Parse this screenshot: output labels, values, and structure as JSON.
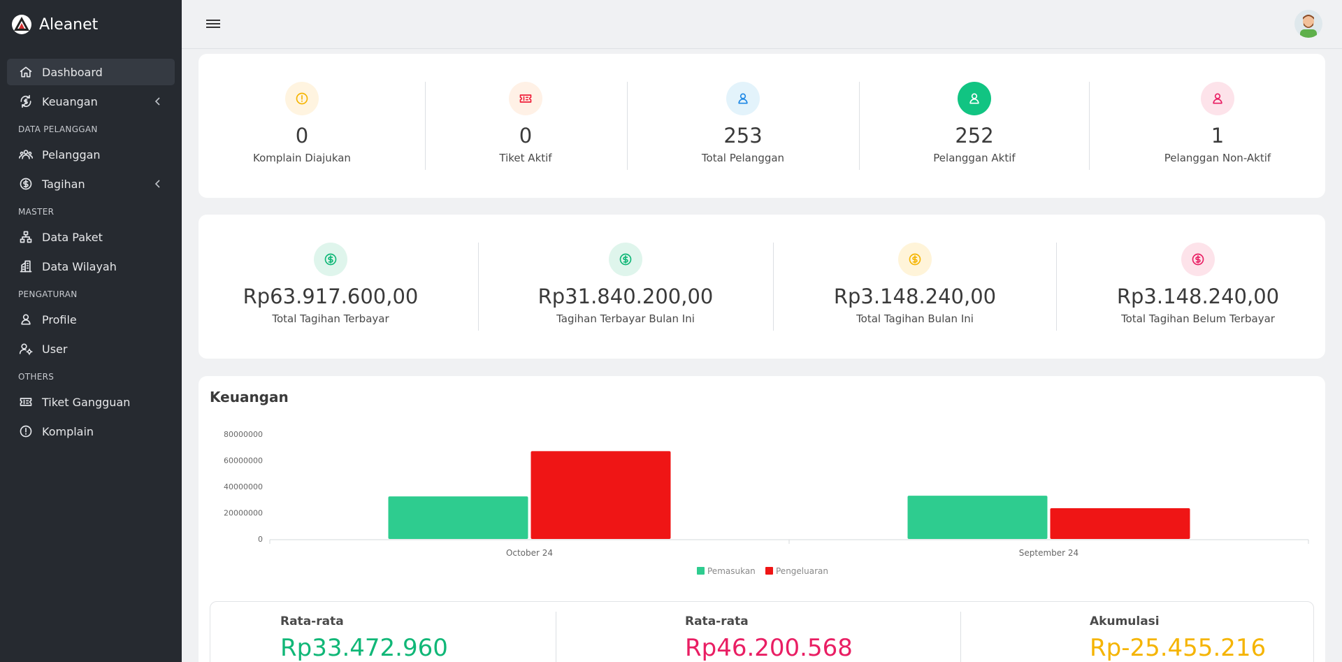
{
  "app": {
    "name": "Aleanet"
  },
  "sidebar": {
    "items": [
      {
        "type": "item",
        "label": "Dashboard",
        "icon": "home-icon",
        "active": true
      },
      {
        "type": "item",
        "label": "Keuangan",
        "icon": "finance-icon",
        "chevron": true
      },
      {
        "type": "section",
        "label": "DATA PELANGGAN"
      },
      {
        "type": "item",
        "label": "Pelanggan",
        "icon": "users-icon"
      },
      {
        "type": "item",
        "label": "Tagihan",
        "icon": "dollar-circle-icon",
        "chevron": true
      },
      {
        "type": "section",
        "label": "MASTER"
      },
      {
        "type": "item",
        "label": "Data Paket",
        "icon": "sitemap-icon"
      },
      {
        "type": "item",
        "label": "Data Wilayah",
        "icon": "building-icon"
      },
      {
        "type": "section",
        "label": "PENGATURAN"
      },
      {
        "type": "item",
        "label": "Profile",
        "icon": "user-icon"
      },
      {
        "type": "item",
        "label": "User",
        "icon": "user-gear-icon"
      },
      {
        "type": "section",
        "label": "OTHERS"
      },
      {
        "type": "item",
        "label": "Tiket Gangguan",
        "icon": "ticket-icon"
      },
      {
        "type": "item",
        "label": "Komplain",
        "icon": "alert-circle-icon"
      }
    ]
  },
  "stats_row1": [
    {
      "value": "0",
      "label": "Komplain Diajukan",
      "icon": "alert-circle-icon",
      "bg": "#fff4e0",
      "fg": "#f5b400"
    },
    {
      "value": "0",
      "label": "Tiket Aktif",
      "icon": "ticket-icon",
      "bg": "#fff1e6",
      "fg": "#ef1f3a"
    },
    {
      "value": "253",
      "label": "Total Pelanggan",
      "icon": "user-icon",
      "bg": "#e3f3fb",
      "fg": "#1e88e5"
    },
    {
      "value": "252",
      "label": "Pelanggan Aktif",
      "icon": "user-icon",
      "bg": "#11c482",
      "fg": "#ffffff"
    },
    {
      "value": "1",
      "label": "Pelanggan Non-Aktif",
      "icon": "user-icon",
      "bg": "#fde3ea",
      "fg": "#e91e63"
    }
  ],
  "stats_row2": [
    {
      "value": "Rp63.917.600,00",
      "label": "Total Tagihan Terbayar",
      "icon": "dollar-circle-icon",
      "bg": "#dff5ec",
      "fg": "#10b777"
    },
    {
      "value": "Rp31.840.200,00",
      "label": "Tagihan Terbayar Bulan Ini",
      "icon": "dollar-circle-icon",
      "bg": "#dff5ec",
      "fg": "#10b777"
    },
    {
      "value": "Rp3.148.240,00",
      "label": "Total Tagihan Bulan Ini",
      "icon": "dollar-circle-icon",
      "bg": "#fff4d9",
      "fg": "#f5b400"
    },
    {
      "value": "Rp3.148.240,00",
      "label": "Total Tagihan Belum Terbayar",
      "icon": "dollar-circle-icon",
      "bg": "#fde3ea",
      "fg": "#e91e63"
    }
  ],
  "chart_section": {
    "title": "Keuangan"
  },
  "chart_data": {
    "type": "bar",
    "categories": [
      "October 24",
      "September 24"
    ],
    "series": [
      {
        "name": "Pemasukan",
        "color": "#2ecc8f",
        "values": [
          32500000,
          33000000
        ]
      },
      {
        "name": "Pengeluaran",
        "color": "#ef1515",
        "values": [
          67000000,
          23500000
        ]
      }
    ],
    "yticks": [
      "0",
      "20000000",
      "40000000",
      "60000000",
      "80000000"
    ],
    "ylim": [
      0,
      80000000
    ],
    "legend": "bottom"
  },
  "summary": [
    {
      "label": "Rata-rata",
      "value": "Rp33.472.960",
      "color": "#10b777"
    },
    {
      "label": "Rata-rata",
      "value": "Rp46.200.568",
      "color": "#e91e63"
    },
    {
      "label": "Akumulasi",
      "value": "Rp-25.455.216",
      "color": "#f5b400"
    }
  ]
}
